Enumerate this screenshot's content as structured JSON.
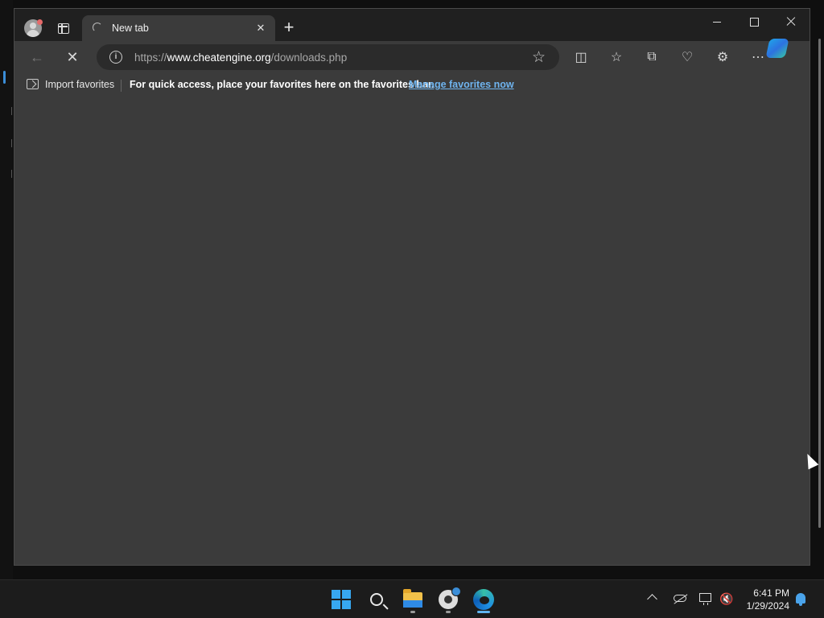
{
  "browser": {
    "tab": {
      "title": "New tab",
      "loading": true
    },
    "address": {
      "scheme": "https://",
      "host": "www.cheatengine.org",
      "path": "/downloads.php"
    },
    "favorites_bar": {
      "import_label": "Import favorites",
      "message": "For quick access, place your favorites here on the favorites bar.",
      "manage_link": "Manage favorites now"
    },
    "toolbar_icons": [
      "back-arrow-icon",
      "stop-loading-icon",
      "site-info-icon",
      "favorite-star-icon",
      "split-screen-icon",
      "favorites-icon",
      "collections-icon",
      "browser-essentials-icon",
      "extensions-icon",
      "more-menu-icon",
      "copilot-icon"
    ],
    "window_controls": [
      "minimize-icon",
      "maximize-icon",
      "close-icon"
    ]
  },
  "taskbar": {
    "apps": [
      "start-windows-icon",
      "search-icon",
      "file-explorer-icon",
      "settings-app-icon",
      "edge-browser-icon"
    ],
    "tray": {
      "time": "6:41 PM",
      "date": "1/29/2024",
      "icons": [
        "chevron-up-icon",
        "onedrive-icon",
        "network-icon",
        "volume-muted-icon",
        "notification-bell-icon"
      ]
    }
  },
  "colors": {
    "accent": "#3b8ed8",
    "link": "#6fb4ef",
    "browser_bg": "#3b3b3b",
    "tabstrip_bg": "#202020",
    "taskbar_bg": "#1c1c1c"
  }
}
